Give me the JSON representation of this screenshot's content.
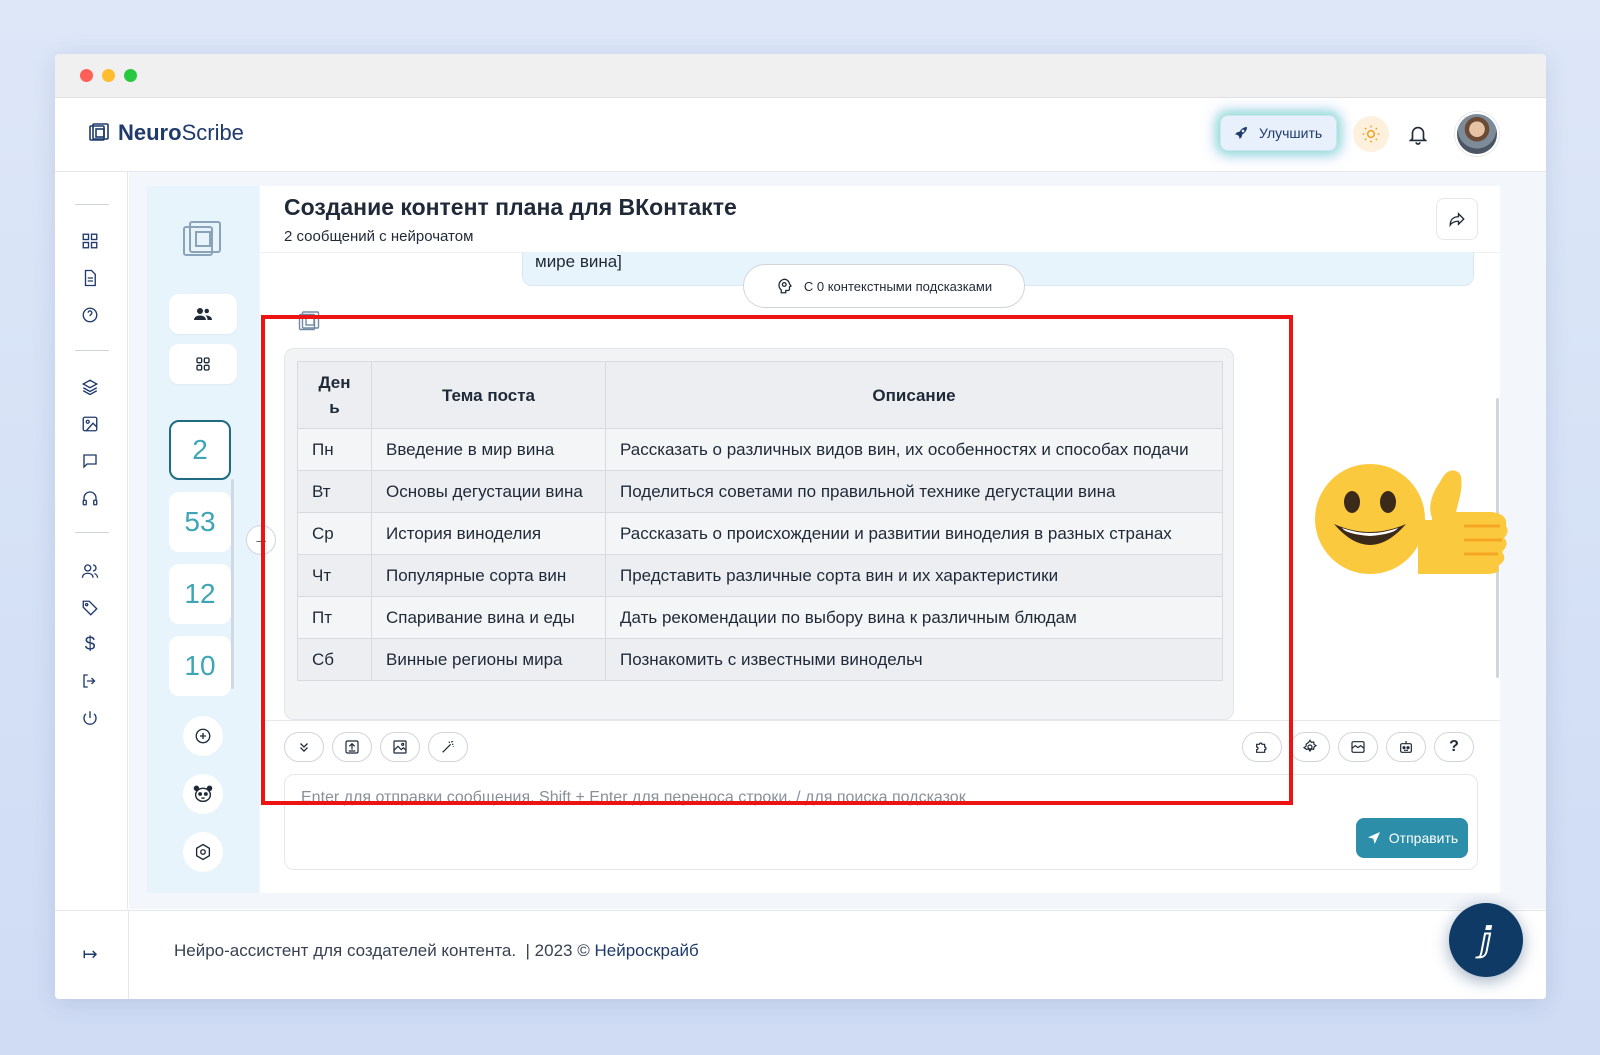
{
  "app": {
    "logo_bold": "Neuro",
    "logo_light": "Scribe",
    "upgrade_label": "Улучшить",
    "icons": [
      "sun-icon",
      "bell-icon",
      "avatar"
    ]
  },
  "left_nav": {
    "items": [
      "dashboard-icon",
      "document-icon",
      "help-circle-icon",
      "layers-icon",
      "image-icon",
      "chat-icon",
      "headphones-icon",
      "users-icon",
      "tag-icon",
      "dollar-icon",
      "logout-icon",
      "power-icon"
    ]
  },
  "side_panel": {
    "counters": [
      "2",
      "53",
      "12",
      "10"
    ]
  },
  "chat": {
    "title": "Создание контент плана для ВКонтакте",
    "subtitle": "2 сообщений с нейрочатом",
    "prev_message_tail": "мире вина]",
    "hints_pill": "С 0 контекстными подсказками",
    "table": {
      "headers": [
        "Ден\nь",
        "Тема поста",
        "Описание"
      ],
      "rows": [
        [
          "Пн",
          "Введение в мир вина",
          "Рассказать о различных видов вин, их особенностях и способах подачи"
        ],
        [
          "Вт",
          "Основы дегустации вина",
          "Поделиться советами по правильной технике дегустации вина"
        ],
        [
          "Ср",
          "История виноделия",
          "Рассказать о происхождении и развитии виноделия в разных странах"
        ],
        [
          "Чт",
          "Популярные сорта вин",
          "Представить различные сорта вин и их характеристики"
        ],
        [
          "Пт",
          "Спаривание вина и еды",
          "Дать рекомендации по выбору вина к различным блюдам"
        ],
        [
          "Сб",
          "Винные регионы мира",
          "Познакомить с известными винодельч"
        ]
      ]
    }
  },
  "composer": {
    "placeholder": "Enter для отправки сообщения, Shift + Enter для переноса строки, / для поиска подсказок",
    "send_label": "Отправить",
    "help_label": "?"
  },
  "footer": {
    "text": "Нейро-ассистент для создателей контента.  | 2023 © ",
    "link": "Нейроскрайб"
  },
  "colors": {
    "accent": "#2d8ea9",
    "brand": "#1f3a6b",
    "highlight": "#ee1313"
  }
}
